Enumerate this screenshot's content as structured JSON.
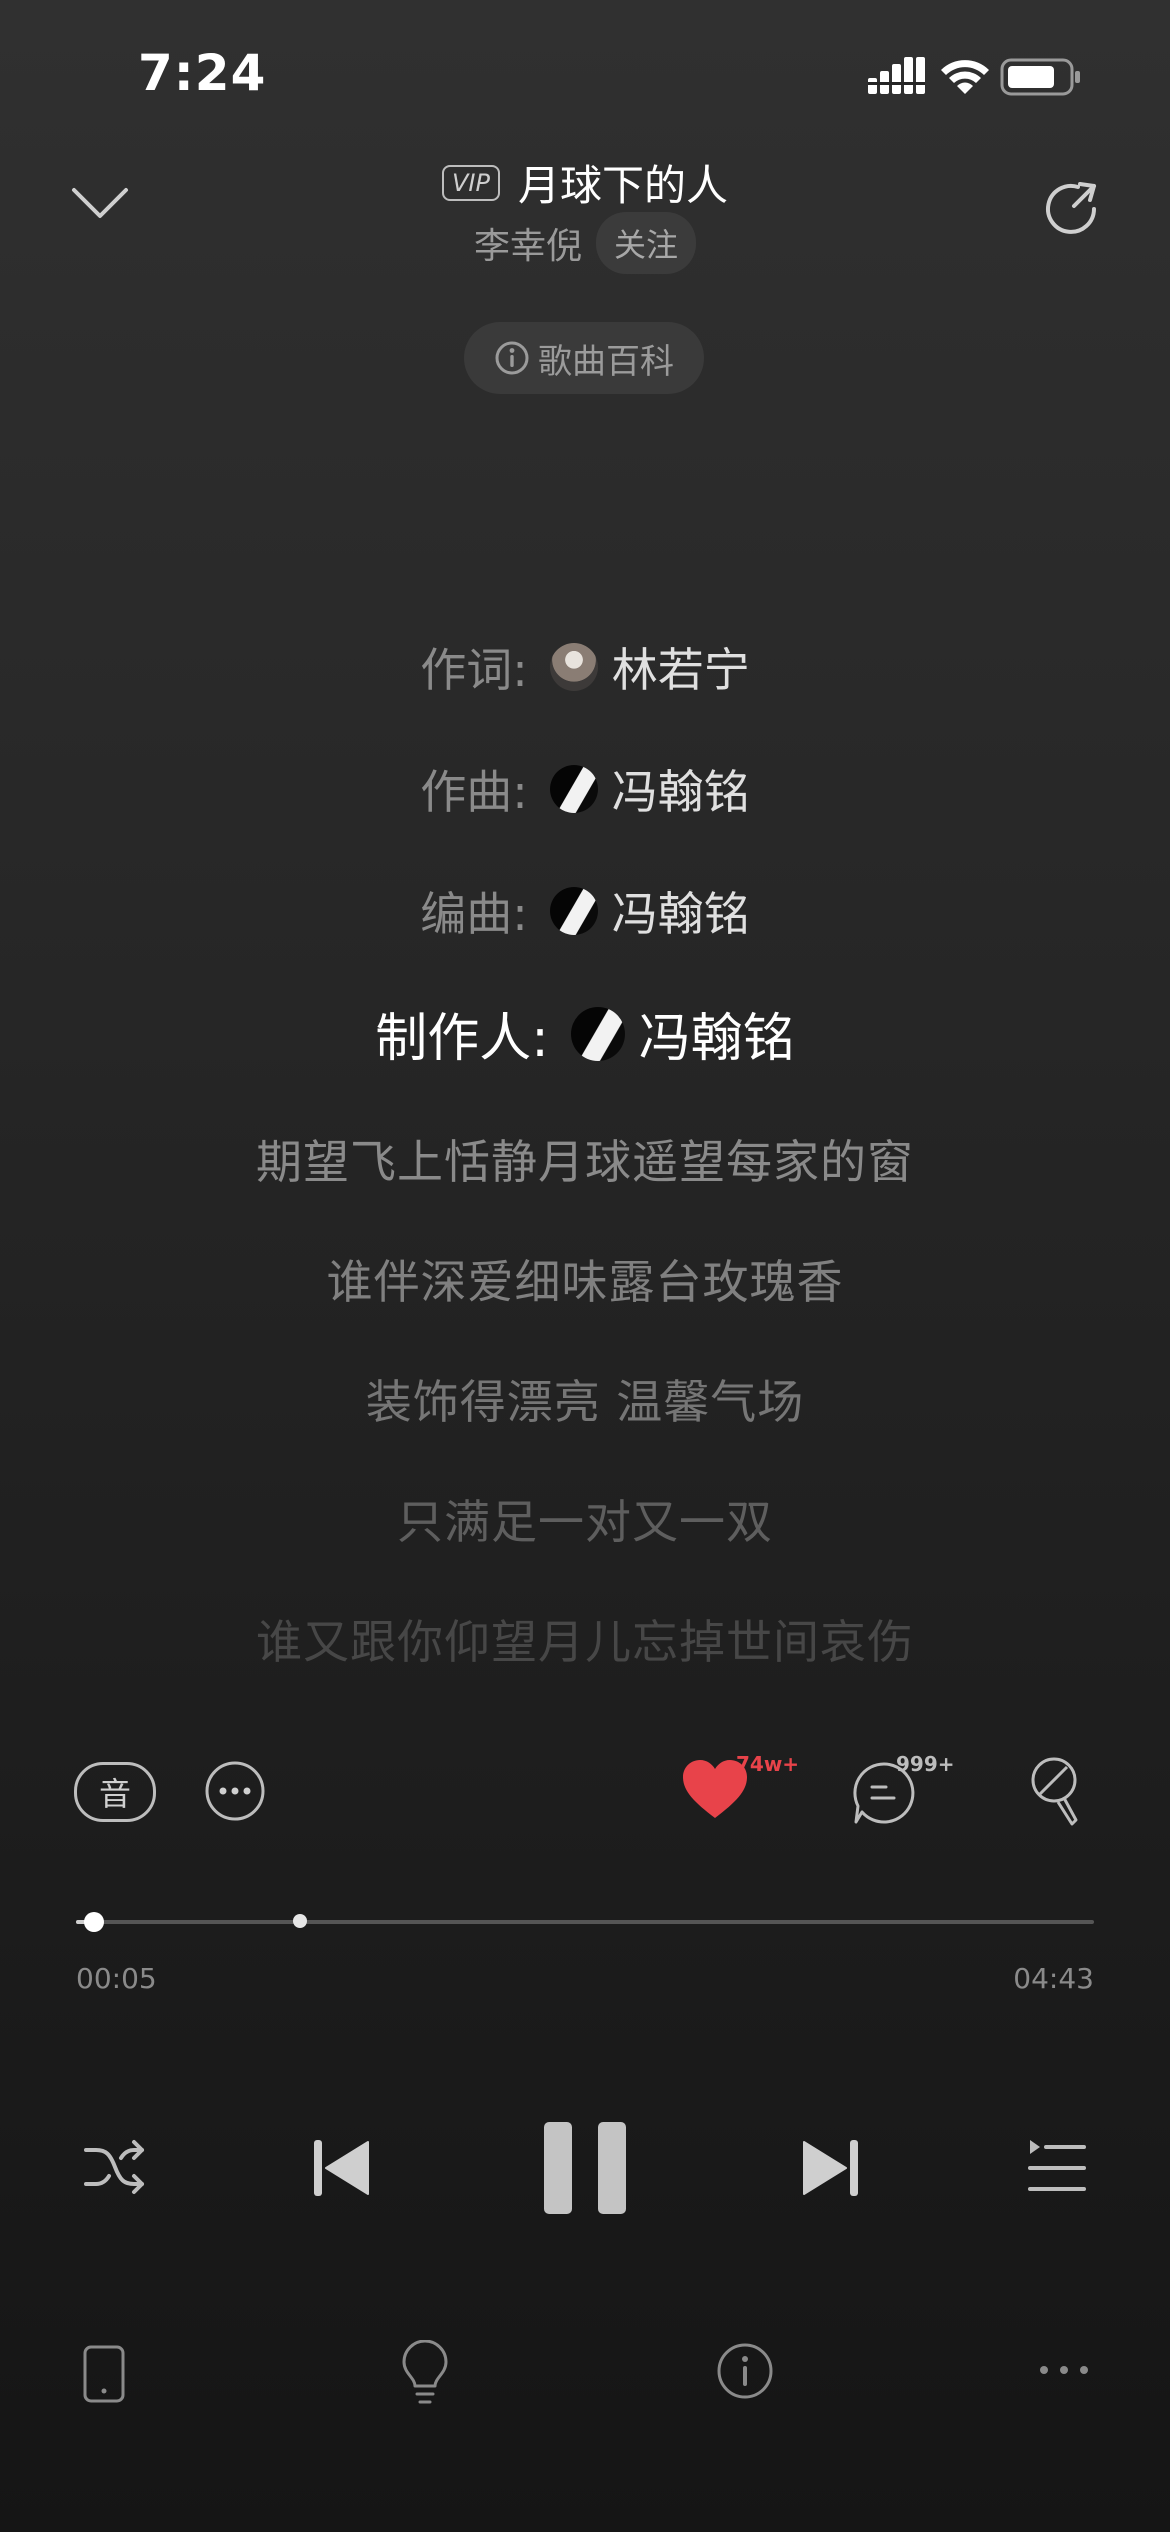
{
  "status_bar": {
    "time": "7:24"
  },
  "header": {
    "vip_label": "VIP",
    "song_title": "月球下的人",
    "artist": "李幸倪",
    "follow_label": "关注",
    "wiki_label": "歌曲百科"
  },
  "credits": [
    {
      "role": "作词:",
      "name": "林若宁"
    },
    {
      "role": "作曲:",
      "name": "冯翰铭"
    },
    {
      "role": "编曲:",
      "name": "冯翰铭"
    },
    {
      "role": "制作人:",
      "name": "冯翰铭"
    }
  ],
  "lyrics": [
    "期望飞上恬静月球遥望每家的窗",
    "谁伴深爱细味露台玫瑰香",
    "装饰得漂亮 温馨气场",
    "只满足一对又一双",
    "谁又跟你仰望月儿忘掉世间哀伤"
  ],
  "actions": {
    "sound_effect_label": "音",
    "like_count": "74w+",
    "comment_count": "999+"
  },
  "progress": {
    "current_time": "00:05",
    "total_time": "04:43",
    "played_fraction": 0.018,
    "buffered_fraction": 0.22
  },
  "colors": {
    "accent_red": "#e8434a",
    "background": "#252525"
  }
}
